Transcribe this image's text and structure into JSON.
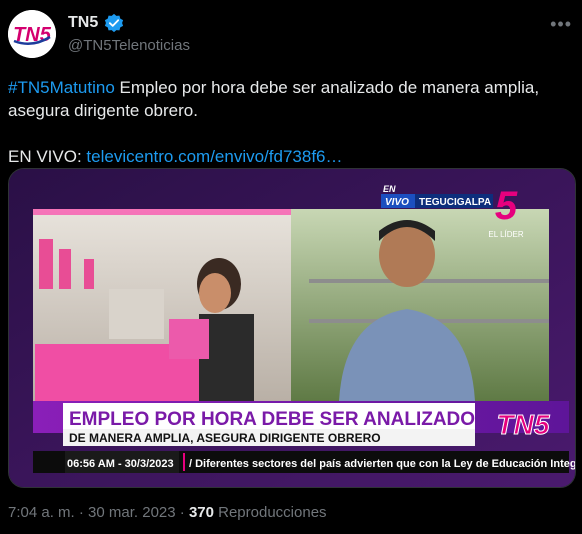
{
  "tweet": {
    "author_name": "TN5",
    "author_handle": "@TN5Telenoticias",
    "more_icon": "more-horizontal-icon",
    "hashtag": "#TN5Matutino",
    "body_line": " Empleo por hora debe ser analizado de manera amplia, asegura dirigente obrero.",
    "live_label": "EN VIVO: ",
    "link": "televicentro.com/envivo/fd738f6…",
    "timestamp": "7:04 a. m. · 30 mar. 2023 · ",
    "views_count": "370",
    "views_label": " Reproducciones"
  },
  "media": {
    "live_en": "EN",
    "live_vivo": "VIVO",
    "location": "TEGUCIGALPA",
    "channel_number": "5",
    "channel_tagline": "EL LÍDER",
    "headline": "EMPLEO POR HORA DEBE SER ANALIZADO",
    "subheadline": "DE MANERA AMPLIA, ASEGURA DIRIGENTE OBRERO",
    "logo_text": "TN5",
    "ticker_time": "06:56 AM - 30/3/2023",
    "ticker_text": "/ Diferentes sectores del país advierten que con la Ley de Educación Integral de"
  },
  "colors": {
    "accent": "#1d9bf0",
    "brand_magenta": "#e6007e",
    "live_blue": "#1b4fbf"
  }
}
